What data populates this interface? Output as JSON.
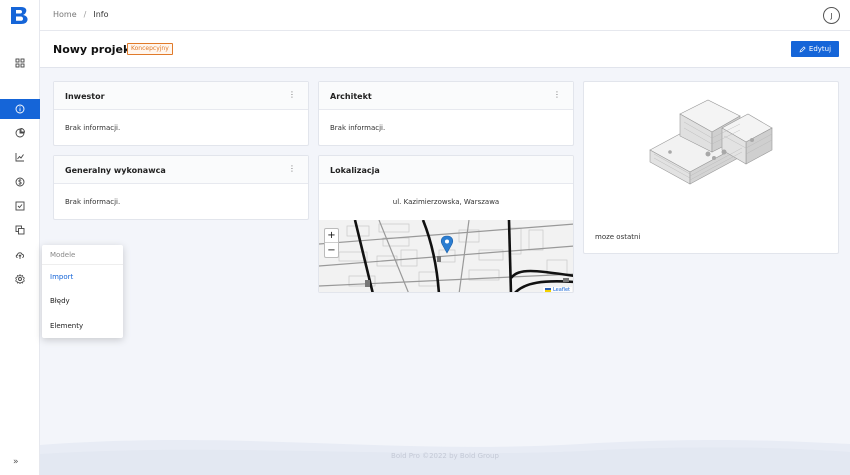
{
  "app": {
    "logo_letter": "B"
  },
  "breadcrumb": {
    "home": "Home",
    "separator": "/",
    "current": "Info"
  },
  "user": {
    "avatar_initial": "J"
  },
  "header": {
    "title": "Nowy projekt",
    "status_badge": "Koncepcyjny",
    "edit_label": "Edytuj"
  },
  "cards": {
    "investor": {
      "title": "Inwestor",
      "body": "Brak informacji."
    },
    "architect": {
      "title": "Architekt",
      "body": "Brak informacji."
    },
    "contractor": {
      "title": "Generalny wykonawca",
      "body": "Brak informacji."
    },
    "location": {
      "title": "Lokalizacja",
      "address": "ul. Kazimierzowska, Warszawa",
      "zoom_in": "+",
      "zoom_out": "−",
      "attribution": "Leaflet"
    },
    "model": {
      "caption": "moze ostatni"
    }
  },
  "models_menu": {
    "header": "Modele",
    "items": [
      {
        "label": "Import"
      },
      {
        "label": "Błędy"
      },
      {
        "label": "Elementy"
      }
    ]
  },
  "footer": {
    "text": "Bold Pro ©2022 by Bold Group"
  },
  "colors": {
    "accent": "#1565d8",
    "badge": "#e07a2a",
    "background": "#f3f5fa"
  }
}
